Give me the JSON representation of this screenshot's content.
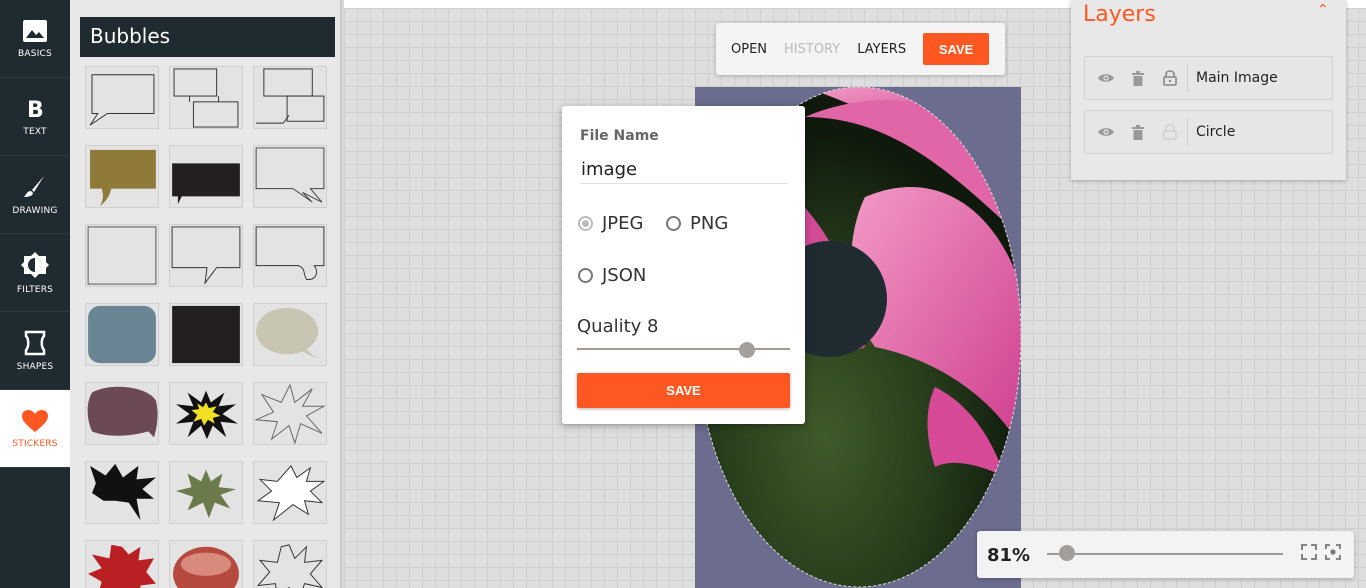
{
  "rail": {
    "items": [
      {
        "label": "BASICS",
        "icon": "image-icon"
      },
      {
        "label": "TEXT",
        "icon": "bold-b-icon"
      },
      {
        "label": "DRAWING",
        "icon": "brush-icon"
      },
      {
        "label": "FILTERS",
        "icon": "contrast-icon"
      },
      {
        "label": "SHAPES",
        "icon": "shape-icon"
      },
      {
        "label": "STICKERS",
        "icon": "heart-icon"
      }
    ],
    "active": "STICKERS"
  },
  "panel": {
    "title": "Bubbles"
  },
  "toolbar": {
    "open": "OPEN",
    "history": "HISTORY",
    "layers": "LAYERS",
    "save": "SAVE"
  },
  "dialog": {
    "file_name_label": "File Name",
    "file_name_value": "image",
    "format_jpeg": "JPEG",
    "format_png": "PNG",
    "format_json": "JSON",
    "selected_format": "JPEG",
    "quality_label": "Quality 8",
    "quality_value": 8,
    "quality_max": 10,
    "save": "SAVE"
  },
  "layers": {
    "title": "Layers",
    "items": [
      {
        "name": "Main Image",
        "locked": true
      },
      {
        "name": "Circle",
        "locked": false
      }
    ]
  },
  "zoom": {
    "value": "81%",
    "level": 0.05
  },
  "colors": {
    "accent": "#ff5722",
    "dark": "#1f2b31"
  }
}
